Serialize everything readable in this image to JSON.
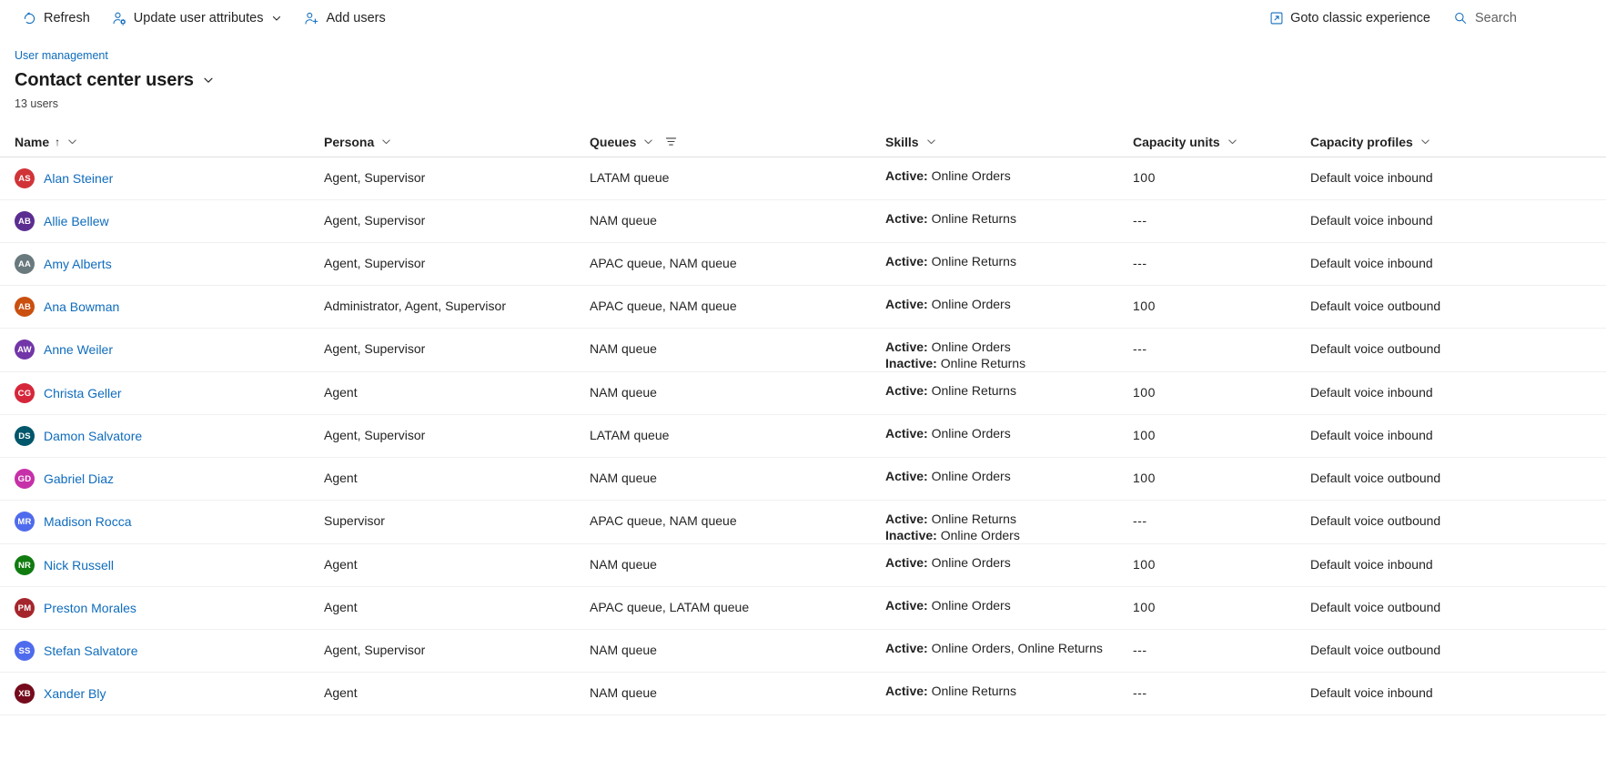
{
  "toolbar": {
    "refresh": "Refresh",
    "update_user_attributes": "Update user attributes",
    "add_users": "Add users",
    "goto_classic": "Goto classic experience",
    "search_placeholder": "Search"
  },
  "header": {
    "breadcrumb": "User management",
    "title": "Contact center users",
    "count": "13 users"
  },
  "columns": [
    {
      "key": "name",
      "label": "Name",
      "sort": "↑"
    },
    {
      "key": "persona",
      "label": "Persona"
    },
    {
      "key": "queues",
      "label": "Queues",
      "filtered": true
    },
    {
      "key": "skills",
      "label": "Skills"
    },
    {
      "key": "capacity_units",
      "label": "Capacity units"
    },
    {
      "key": "capacity_profiles",
      "label": "Capacity profiles"
    }
  ],
  "colors": {
    "link": "#0f6cbd",
    "text": "#242424",
    "row_border": "#f0f0f0",
    "header_border": "#e0e0e0"
  },
  "rows": [
    {
      "initials": "AS",
      "avatar_color": "#d13438",
      "name": "Alan Steiner",
      "persona": "Agent, Supervisor",
      "queues": "LATAM queue",
      "skills": [
        {
          "state": "Active:",
          "value": "Online Orders"
        }
      ],
      "capacity_units": "100",
      "capacity_profiles": "Default voice inbound"
    },
    {
      "initials": "AB",
      "avatar_color": "#5c2d91",
      "name": "Allie Bellew",
      "persona": "Agent, Supervisor",
      "queues": "NAM queue",
      "skills": [
        {
          "state": "Active:",
          "value": "Online Returns"
        }
      ],
      "capacity_units": "---",
      "capacity_profiles": "Default voice inbound"
    },
    {
      "initials": "AA",
      "avatar_color": "#69797e",
      "name": "Amy Alberts",
      "persona": "Agent, Supervisor",
      "queues": "APAC queue, NAM queue",
      "skills": [
        {
          "state": "Active:",
          "value": "Online Returns"
        }
      ],
      "capacity_units": "---",
      "capacity_profiles": "Default voice inbound"
    },
    {
      "initials": "AB",
      "avatar_color": "#ca5010",
      "name": "Ana Bowman",
      "persona": "Administrator, Agent, Supervisor",
      "queues": "APAC queue, NAM queue",
      "skills": [
        {
          "state": "Active:",
          "value": "Online Orders"
        }
      ],
      "capacity_units": "100",
      "capacity_profiles": "Default voice outbound"
    },
    {
      "initials": "AW",
      "avatar_color": "#7236a8",
      "name": "Anne Weiler",
      "persona": "Agent, Supervisor",
      "queues": "NAM queue",
      "skills": [
        {
          "state": "Active:",
          "value": "Online Orders"
        },
        {
          "state": "Inactive:",
          "value": "Online Returns"
        }
      ],
      "capacity_units": "---",
      "capacity_profiles": "Default voice outbound"
    },
    {
      "initials": "CG",
      "avatar_color": "#d6263b",
      "name": "Christa Geller",
      "persona": "Agent",
      "queues": "NAM queue",
      "skills": [
        {
          "state": "Active:",
          "value": "Online Returns"
        }
      ],
      "capacity_units": "100",
      "capacity_profiles": "Default voice inbound"
    },
    {
      "initials": "DS",
      "avatar_color": "#00566b",
      "name": "Damon Salvatore",
      "persona": "Agent, Supervisor",
      "queues": "LATAM queue",
      "skills": [
        {
          "state": "Active:",
          "value": "Online Orders"
        }
      ],
      "capacity_units": "100",
      "capacity_profiles": "Default voice inbound"
    },
    {
      "initials": "GD",
      "avatar_color": "#c630a8",
      "name": "Gabriel Diaz",
      "persona": "Agent",
      "queues": "NAM queue",
      "skills": [
        {
          "state": "Active:",
          "value": "Online Orders"
        }
      ],
      "capacity_units": "100",
      "capacity_profiles": "Default voice outbound"
    },
    {
      "initials": "MR",
      "avatar_color": "#4f6bed",
      "name": "Madison Rocca",
      "persona": "Supervisor",
      "queues": "APAC queue, NAM queue",
      "skills": [
        {
          "state": "Active:",
          "value": "Online Returns"
        },
        {
          "state": "Inactive:",
          "value": "Online Orders"
        }
      ],
      "capacity_units": "---",
      "capacity_profiles": "Default voice outbound"
    },
    {
      "initials": "NR",
      "avatar_color": "#107c10",
      "name": "Nick Russell",
      "persona": "Agent",
      "queues": "NAM queue",
      "skills": [
        {
          "state": "Active:",
          "value": "Online Orders"
        }
      ],
      "capacity_units": "100",
      "capacity_profiles": "Default voice inbound"
    },
    {
      "initials": "PM",
      "avatar_color": "#a4262c",
      "name": "Preston Morales",
      "persona": "Agent",
      "queues": "APAC queue, LATAM queue",
      "skills": [
        {
          "state": "Active:",
          "value": "Online Orders"
        }
      ],
      "capacity_units": "100",
      "capacity_profiles": "Default voice outbound"
    },
    {
      "initials": "SS",
      "avatar_color": "#4f6bed",
      "name": "Stefan Salvatore",
      "persona": "Agent, Supervisor",
      "queues": "NAM queue",
      "skills": [
        {
          "state": "Active:",
          "value": "Online Orders, Online Returns"
        }
      ],
      "capacity_units": "---",
      "capacity_profiles": "Default voice outbound"
    },
    {
      "initials": "XB",
      "avatar_color": "#750b1c",
      "name": "Xander Bly",
      "persona": "Agent",
      "queues": "NAM queue",
      "skills": [
        {
          "state": "Active:",
          "value": "Online Returns"
        }
      ],
      "capacity_units": "---",
      "capacity_profiles": "Default voice inbound"
    }
  ]
}
